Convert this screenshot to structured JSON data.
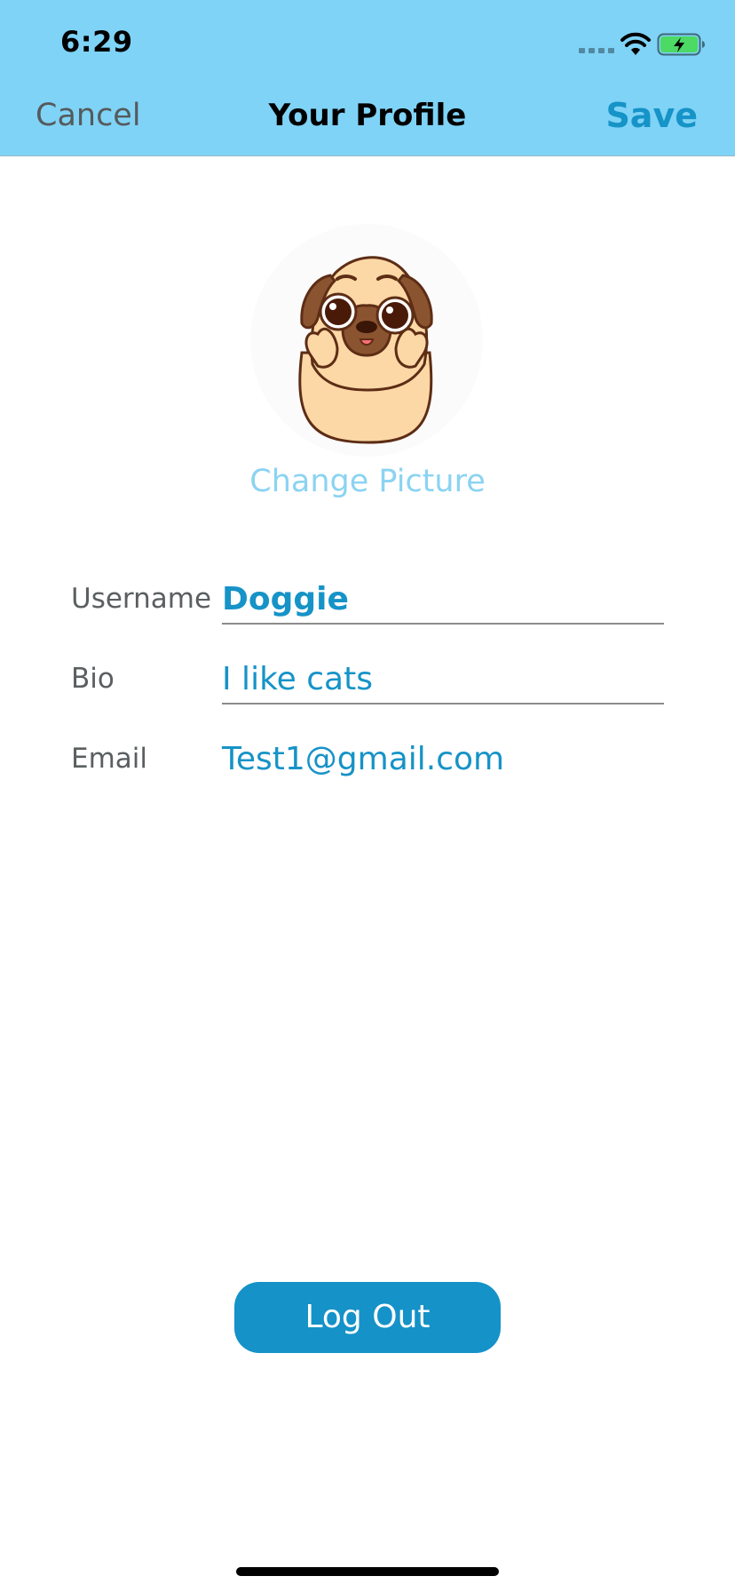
{
  "status_bar": {
    "time": "6:29",
    "icons": [
      "cellular-signal-icon",
      "wifi-icon",
      "battery-charging-icon"
    ]
  },
  "nav": {
    "cancel_label": "Cancel",
    "title": "Your Profile",
    "save_label": "Save"
  },
  "profile": {
    "avatar_icon": "pug-avatar-icon",
    "change_picture_label": "Change Picture"
  },
  "form": {
    "username_label": "Username",
    "username_value": "Doggie",
    "bio_label": "Bio",
    "bio_value": "I like cats",
    "email_label": "Email",
    "email_value": "Test1@gmail.com"
  },
  "logout_label": "Log Out",
  "colors": {
    "header_bg": "#7fd3f6",
    "accent": "#1693c7",
    "link_light": "#8bd3f2",
    "battery_fill": "#4cd964"
  }
}
